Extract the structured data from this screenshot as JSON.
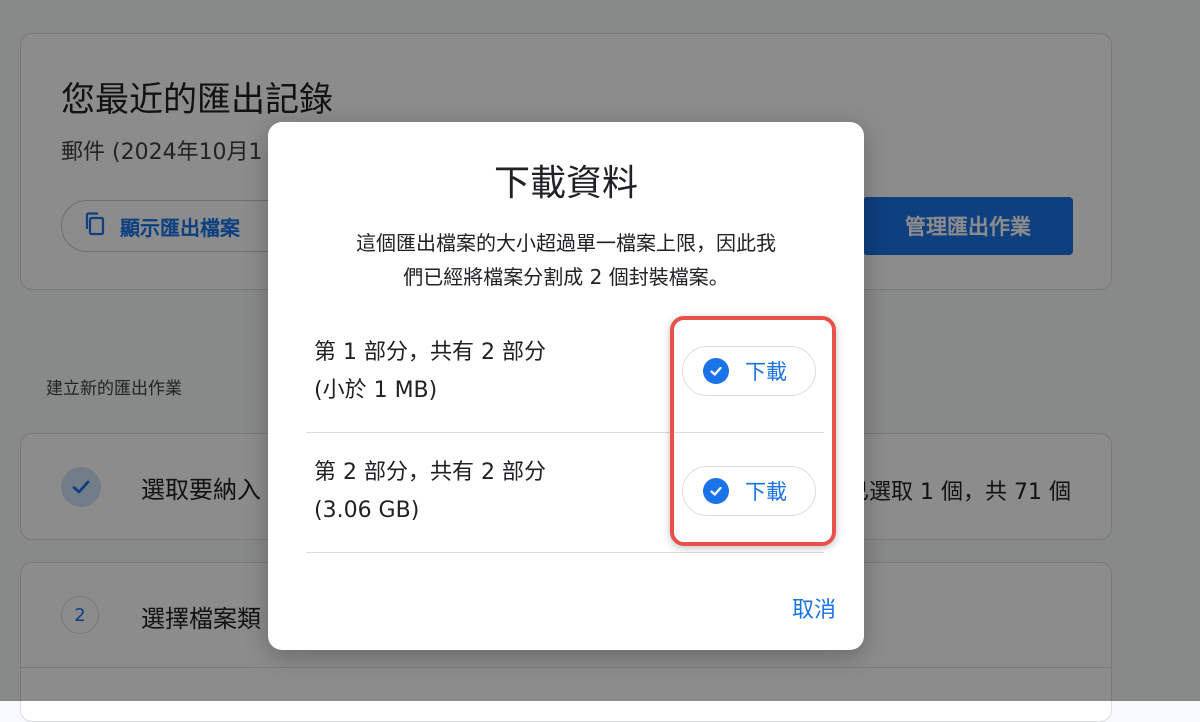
{
  "background": {
    "recent_exports": {
      "title": "您最近的匯出記錄",
      "subtitle": "郵件 (2024年10月1",
      "show_files_label": "顯示匯出檔案",
      "manage_label": "管理匯出作業"
    },
    "new_export_label": "建立新的匯出作業",
    "step1": {
      "title": "選取要納入",
      "count": "已選取 1 個，共 71 個"
    },
    "step2": {
      "number": "2",
      "title": "選擇檔案類"
    }
  },
  "dialog": {
    "title": "下載資料",
    "description_line1": "這個匯出檔案的大小超過單一檔案上限，因此我",
    "description_line2": "們已經將檔案分割成 2 個封裝檔案。",
    "parts": [
      {
        "name": "第 1 部分，共有 2 部分",
        "size": "(小於 1 MB)",
        "button_label": "下載"
      },
      {
        "name": "第 2 部分，共有 2 部分",
        "size": "(3.06 GB)",
        "button_label": "下載"
      }
    ],
    "cancel_label": "取消"
  },
  "colors": {
    "accent": "#1a73e8",
    "highlight": "#e8504a"
  }
}
